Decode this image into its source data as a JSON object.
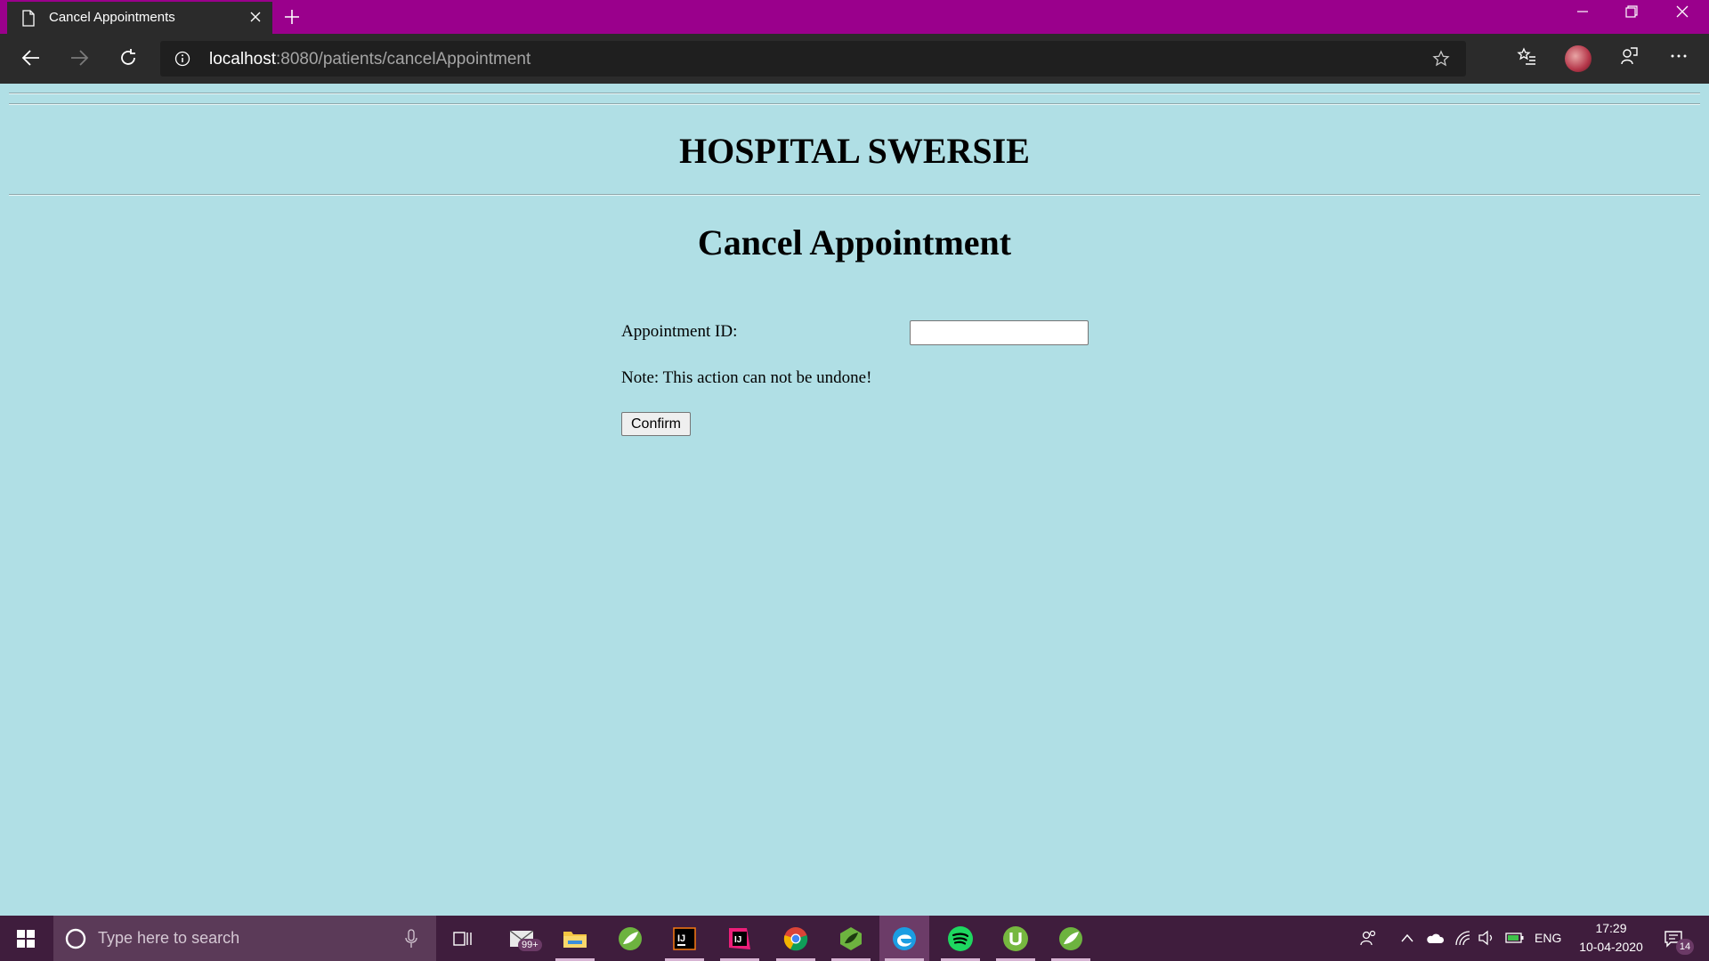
{
  "browser": {
    "tab_title": "Cancel Appointments",
    "url_host": "localhost",
    "url_path": ":8080/patients/cancelAppointment",
    "titlebar_color": "#9a008c"
  },
  "page": {
    "site_title": "HOSPITAL SWERSIE",
    "heading": "Cancel Appointment",
    "appointment_label": "Appointment ID:",
    "appointment_value": "",
    "note": "Note: This action can not be undone!",
    "confirm_label": "Confirm",
    "background_color": "#b0dfe5"
  },
  "taskbar": {
    "search_placeholder": "Type here to search",
    "mail_badge": "99+",
    "language": "ENG",
    "time": "17:29",
    "date": "10-04-2020",
    "notification_count": "14",
    "apps": [
      "task-view-icon",
      "mail-icon",
      "file-explorer-icon",
      "spring-tool-icon",
      "intellij-icon",
      "intellij-alt-icon",
      "chrome-icon",
      "spring-boot-icon",
      "edge-icon",
      "spotify-icon",
      "utorrent-icon",
      "spring-icon"
    ]
  }
}
